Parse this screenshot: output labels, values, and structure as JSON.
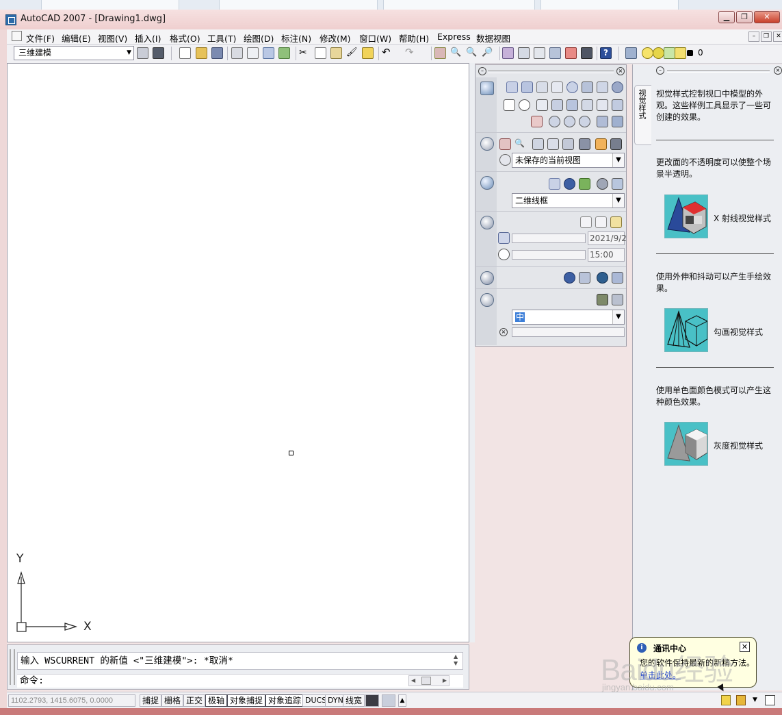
{
  "window": {
    "title": "AutoCAD 2007 - [Drawing1.dwg]",
    "minimize_glyph": "▁",
    "maximize_glyph": "❐",
    "close_glyph": "✕"
  },
  "menu": {
    "items": [
      "文件(F)",
      "编辑(E)",
      "视图(V)",
      "插入(I)",
      "格式(O)",
      "工具(T)",
      "绘图(D)",
      "标注(N)",
      "修改(M)",
      "窗口(W)",
      "帮助(H)",
      "Express",
      "数据视图"
    ],
    "mdi_buttons": [
      "–",
      "❐",
      "✕"
    ]
  },
  "toolbar": {
    "workspace": "三维建模",
    "layer_value": "0",
    "help_glyph": "?",
    "icons": [
      "new-icon",
      "open-icon",
      "save-icon",
      "plot-icon",
      "plot-preview-icon",
      "publish-icon",
      "3d-dwf-icon",
      "cut-icon",
      "copy-icon",
      "paste-icon",
      "match-properties-icon",
      "block-editor-icon",
      "undo-icon",
      "redo-icon",
      "pan-icon",
      "zoom-realtime-icon",
      "zoom-window-icon",
      "zoom-previous-icon",
      "properties-icon",
      "design-center-icon",
      "tool-palettes-icon",
      "sheet-set-icon",
      "markup-icon",
      "quickcalc-icon",
      "help-icon"
    ]
  },
  "ucs": {
    "y_label": "Y",
    "x_label": "X"
  },
  "command": {
    "history": "输入 WSCURRENT 的新值 <\"三维建模\">: *取消*",
    "prompt": "命令:"
  },
  "dashboard": {
    "view_select": "未保存的当前视图",
    "visual_style_select": "二维线框",
    "date_value": "2021/9/2",
    "time_value": "15:00",
    "material_select": "中"
  },
  "palette": {
    "tab_label": "视觉样式",
    "intro": "视觉样式控制视口中模型的外观。这些样例工具显示了一些可创建的效果。",
    "section1_text": "更改面的不透明度可以使整个场景半透明。",
    "item1": "X 射线视觉样式",
    "section2_text": "使用外伸和抖动可以产生手绘效果。",
    "item2": "勾画视觉样式",
    "section3_text": "使用单色面颜色模式可以产生这种颜色效果。",
    "item3": "灰度视觉样式"
  },
  "statusbar": {
    "coords": "1102.2793, 1415.6075, 0.0000",
    "buttons": [
      {
        "label": "捕捉",
        "on": false
      },
      {
        "label": "栅格",
        "on": false
      },
      {
        "label": "正交",
        "on": false
      },
      {
        "label": "极轴",
        "on": true
      },
      {
        "label": "对象捕捉",
        "on": true
      },
      {
        "label": "对象追踪",
        "on": true
      },
      {
        "label": "DUCS",
        "on": false
      },
      {
        "label": "DYN",
        "on": false
      },
      {
        "label": "线宽",
        "on": false
      }
    ]
  },
  "balloon": {
    "title": "通讯中心",
    "body": "您的软件保持最新的新精方法。",
    "link": "单击此处。"
  },
  "watermark": {
    "main": "Baidu经验",
    "sub": "jingyan.baidu.com"
  },
  "colors": {
    "titlebar": "#efcfcf",
    "accent_blue": "#2c6aa8",
    "palette_thumb": "#49c0c6",
    "balloon": "#ffffe1"
  }
}
